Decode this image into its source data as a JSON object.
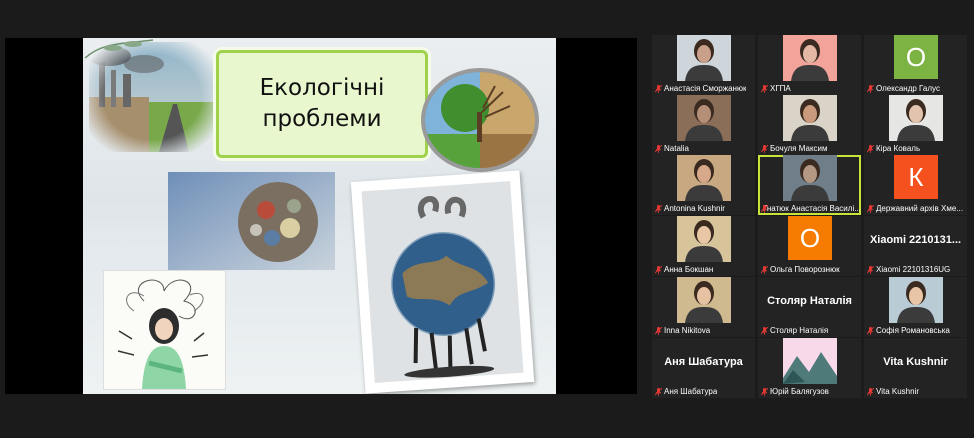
{
  "slide": {
    "title_line1": "Екологічні",
    "title_line2": "проблеми"
  },
  "participants": [
    {
      "name": "Анастасія Сморжанюк",
      "type": "video",
      "skin": "#c9a08a",
      "bg": "#cfd6db"
    },
    {
      "name": "ХГПА",
      "type": "video",
      "skin": "#e3b7a4",
      "bg": "#f2a39a"
    },
    {
      "name": "Олександр Галус",
      "type": "letter",
      "letter": "О",
      "color": "#7cb342"
    },
    {
      "name": "Natalia",
      "type": "video",
      "skin": "#b58e77",
      "bg": "#8a6e58"
    },
    {
      "name": "Бочуля Максим",
      "type": "video",
      "skin": "#c99b7c",
      "bg": "#d9d4c7"
    },
    {
      "name": "Кіра Коваль",
      "type": "video",
      "skin": "#e2c3ad",
      "bg": "#e6e6e4"
    },
    {
      "name": "Antonina Kushnir",
      "type": "video",
      "skin": "#d7a98a",
      "bg": "#c8a880"
    },
    {
      "name": "Гнатюк Анастасія Василі...",
      "type": "video",
      "skin": "#b39984",
      "bg": "#6f7e88",
      "active": true
    },
    {
      "name": "Державний архів Хме...",
      "type": "letter",
      "letter": "К",
      "color": "#f5511e"
    },
    {
      "name": "Анна Бокшан",
      "type": "video",
      "skin": "#e9c7a6",
      "bg": "#d7c49a"
    },
    {
      "name": "Ольга Поворознюк",
      "type": "letter",
      "letter": "О",
      "color": "#f57c00"
    },
    {
      "name": "Xiaomi 22101316UG",
      "type": "big",
      "big": "Xiaomi  2210131..."
    },
    {
      "name": "Inna Nikitova",
      "type": "video",
      "skin": "#e6c2a2",
      "bg": "#cfb98f"
    },
    {
      "name": "Столяр Наталія",
      "type": "big",
      "big": "Столяр Наталія"
    },
    {
      "name": "Софія Романовська",
      "type": "video",
      "skin": "#e8c6a5",
      "bg": "#b9ccd6"
    },
    {
      "name": "Аня Шабатура",
      "type": "big",
      "big": "Аня Шабатура"
    },
    {
      "name": "Юрій Балягузов",
      "type": "picture"
    },
    {
      "name": "Vita Kushnir",
      "type": "big",
      "big": "Vita Kushnir"
    }
  ],
  "colors": {
    "active_border": "#c9e33b",
    "muted_mic": "#e53935",
    "title_border": "#9fd24a"
  }
}
